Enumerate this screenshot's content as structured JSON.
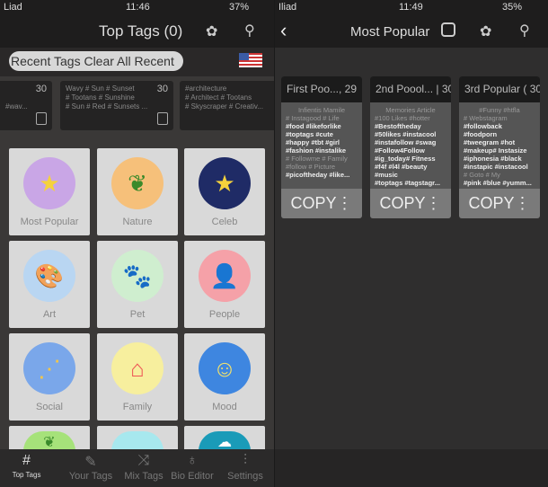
{
  "left": {
    "status": {
      "carrier": "Liad",
      "time": "11:46",
      "battery": "37%"
    },
    "title": "Top Tags (0)",
    "recent_label": "Recent Tags Clear All Recent",
    "recent_cards": [
      {
        "count": "30",
        "line1": "",
        "line2": "#wav..."
      },
      {
        "count": "30",
        "line1": "Wavy # Sun # Sunset",
        "line2": "# Tootans # Sunshine",
        "line3": "# Sun # Red # Sunsets ..."
      },
      {
        "count": "30",
        "line1": "#architecture",
        "line2": "# Architect # Tootans",
        "line3": "# Skyscraper # Creativ..."
      }
    ],
    "categories": [
      {
        "label": "Most Popular",
        "icon": "star",
        "color": "#c9a6e6"
      },
      {
        "label": "Nature",
        "icon": "leaf",
        "color": "#f6c07a"
      },
      {
        "label": "Celeb",
        "icon": "star",
        "color": "#1f2b66"
      },
      {
        "label": "Art",
        "icon": "palette",
        "color": "#b9d6f2"
      },
      {
        "label": "Pet",
        "icon": "paw",
        "color": "#cfeecf"
      },
      {
        "label": "People",
        "icon": "person",
        "color": "#f5a1a8"
      },
      {
        "label": "Social",
        "icon": "share",
        "color": "#7aa7ea"
      },
      {
        "label": "Family",
        "icon": "house",
        "color": "#f7ef9e"
      },
      {
        "label": "Mood",
        "icon": "smiley",
        "color": "#3e86e0"
      },
      {
        "label": "",
        "icon": "leaf",
        "color": "#a6e27a"
      },
      {
        "label": "",
        "icon": "",
        "color": "#a7e8ee"
      },
      {
        "label": "",
        "icon": "cloud",
        "color": "#1a9bb8"
      }
    ],
    "tabs": [
      "Top Tags",
      "Your Tags",
      "Mix Tags",
      "Bio Editor",
      "Settings"
    ]
  },
  "right": {
    "status": {
      "carrier": "Iliad",
      "time": "11:49",
      "battery": "35%"
    },
    "title": "Most Popular",
    "cards": [
      {
        "header": "First Poo..., 29",
        "faded_top": "Infientis Mamile",
        "faded2": "# Instagood # Life",
        "tags": [
          "#food #likeforlike",
          "#toptags #cute",
          "#happy #tbt #girl",
          "#fashion #instalike"
        ],
        "faded3": "# Followme # Family #follow # Picture",
        "tail": "#picoftheday #like...",
        "copy": "COPY"
      },
      {
        "header": "2nd Poool... | 30",
        "faded_top": "Memories Article",
        "faded2": "#100 Likes #hotter",
        "tags": [
          "#Bestoftheday",
          "#50likes #instacool",
          "#instafollow #swag",
          "#Follow4Follow",
          "#ig_today# Fitness",
          "#f4f #l4l #beauty",
          "#music"
        ],
        "faded3": "",
        "tail": "#toptags #tagstagr...",
        "copy": "COPY"
      },
      {
        "header": "3rd Popular ( 30",
        "faded_top": "#Funny #htfla",
        "faded2": "# Webstagram",
        "tags": [
          "#followback",
          "#foodporn",
          "#tweegram #hot",
          "#makeup# Instasize",
          "#iphonesia #black",
          "#instapic #instacool"
        ],
        "faded3": "# Goto # My",
        "tail": "#pink #blue #yumm...",
        "copy": "COPY"
      }
    ]
  }
}
